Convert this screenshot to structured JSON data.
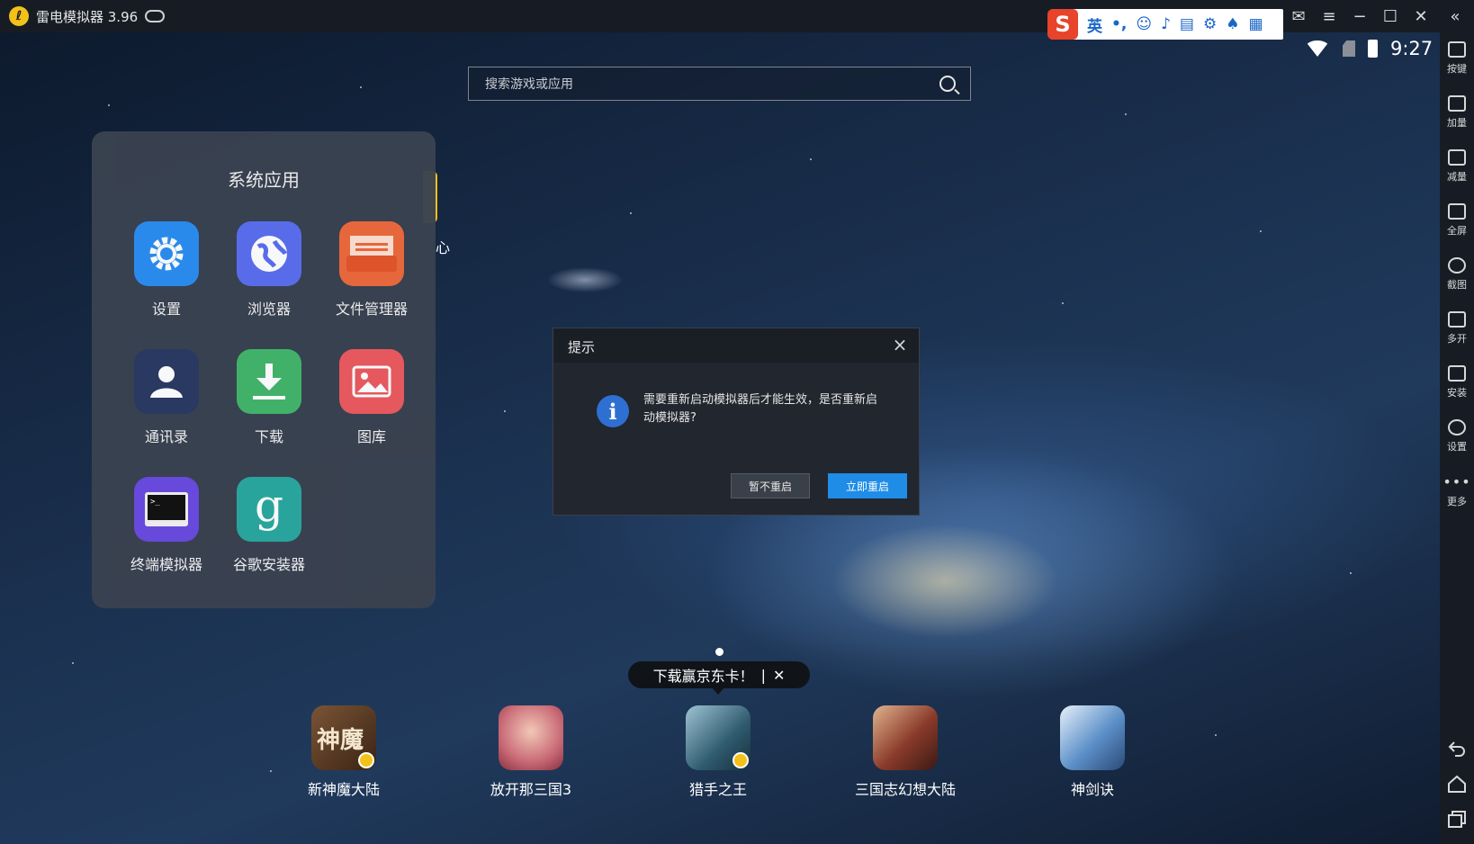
{
  "window": {
    "title": "雷电模拟器 3.96",
    "ime_lang": "英",
    "ime_punct": "•,"
  },
  "status": {
    "time": "9:27"
  },
  "search": {
    "placeholder": "搜索游戏或应用"
  },
  "folder": {
    "title": "系统应用",
    "peek_label": "心",
    "apps": [
      {
        "label": "设置",
        "icon": "settings-gear-icon",
        "color": "#2b8ef2"
      },
      {
        "label": "浏览器",
        "icon": "browser-globe-icon",
        "color": "#5b6ff0"
      },
      {
        "label": "文件管理器",
        "icon": "file-manager-icon",
        "color": "#ee6a3c"
      },
      {
        "label": "通讯录",
        "icon": "contacts-person-icon",
        "color": "#2b3a63"
      },
      {
        "label": "下载",
        "icon": "download-arrow-icon",
        "color": "#43b66b"
      },
      {
        "label": "图库",
        "icon": "gallery-picture-icon",
        "color": "#ec5a5f"
      },
      {
        "label": "终端模拟器",
        "icon": "terminal-icon",
        "color": "#6a4ae0"
      },
      {
        "label": "谷歌安装器",
        "icon": "google-installer-icon",
        "color": "#2aa89f"
      }
    ]
  },
  "dialog": {
    "title": "提示",
    "message": "需要重新启动模拟器后才能生效，是否重新启动模拟器?",
    "cancel_label": "暂不重启",
    "confirm_label": "立即重启"
  },
  "promo": {
    "text": "下载赢京东卡！",
    "separator": "|",
    "close": "✕"
  },
  "dock": [
    {
      "label": "新神魔大陆",
      "icon_text": "神魔",
      "color": "#5a3a24"
    },
    {
      "label": "放开那三国3",
      "icon_text": "",
      "color": "#c96b77"
    },
    {
      "label": "猎手之王",
      "icon_text": "",
      "color": "#2f5a6e"
    },
    {
      "label": "三国志幻想大陆",
      "icon_text": "",
      "color": "#8a3a2a"
    },
    {
      "label": "神剑诀",
      "icon_text": "",
      "color": "#5c8fc8"
    }
  ],
  "toolbar": [
    {
      "label": "按键",
      "icon": "keyboard-icon"
    },
    {
      "label": "加量",
      "icon": "volume-up-icon"
    },
    {
      "label": "减量",
      "icon": "volume-down-icon"
    },
    {
      "label": "全屏",
      "icon": "fullscreen-icon"
    },
    {
      "label": "截图",
      "icon": "screenshot-scissors-icon"
    },
    {
      "label": "多开",
      "icon": "multi-instance-icon"
    },
    {
      "label": "安装",
      "icon": "apk-install-icon"
    },
    {
      "label": "设置",
      "icon": "settings-icon"
    },
    {
      "label": "更多",
      "icon": "more-dots-icon"
    }
  ]
}
